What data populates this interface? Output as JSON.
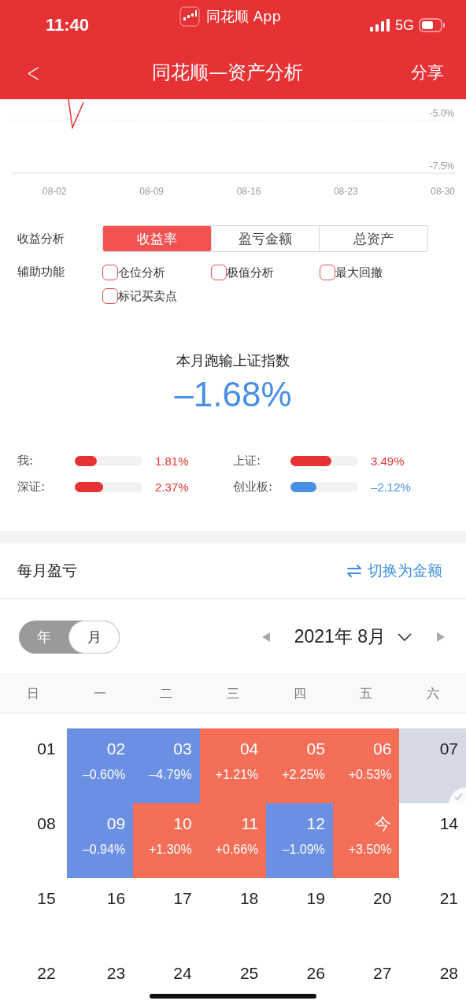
{
  "status_bar": {
    "time": "11:40",
    "app": "同花顺 App",
    "network": "5G"
  },
  "nav": {
    "back": "<",
    "title": "同花顺—资产分析",
    "action": "分享"
  },
  "chart": {
    "y_labels": [
      "-5.0%",
      "-7.5%"
    ],
    "x_labels": [
      "08-02",
      "08-09",
      "08-16",
      "08-23",
      "08-30"
    ]
  },
  "analysis": {
    "label": "收益分析",
    "tabs": [
      {
        "label": "收益率",
        "selected": true
      },
      {
        "label": "盈亏金额",
        "selected": false
      },
      {
        "label": "总资产",
        "selected": false
      }
    ]
  },
  "aux": {
    "label": "辅助功能",
    "options": [
      {
        "label": "仓位分析",
        "checked": false
      },
      {
        "label": "极值分析",
        "checked": false
      },
      {
        "label": "最大回撤",
        "checked": false
      },
      {
        "label": "标记买卖点",
        "checked": false
      }
    ]
  },
  "summary": {
    "title": "本月跑输上证指数",
    "value": "–1.68%"
  },
  "compare": [
    {
      "name": "我:",
      "level": 0.33,
      "value": "1.81%",
      "color": "#e63234"
    },
    {
      "name": "上证:",
      "level": 0.61,
      "value": "3.49%",
      "color": "#e63234"
    },
    {
      "name": "深证:",
      "level": 0.42,
      "value": "2.37%",
      "color": "#e63234"
    },
    {
      "name": "创业板:",
      "level": 0.38,
      "value": "–2.12%",
      "color": "#4a8fe6"
    }
  ],
  "monthly": {
    "title": "每月盈亏",
    "switch": "切换为金额"
  },
  "period": {
    "options": [
      {
        "label": "年",
        "selected": false
      },
      {
        "label": "月",
        "selected": true
      }
    ],
    "month": "2021年 8月"
  },
  "weekdays": [
    "日",
    "一",
    "二",
    "三",
    "四",
    "五",
    "六"
  ],
  "days": [
    {
      "day": "01",
      "kind": "plain"
    },
    {
      "day": "02",
      "change": "–0.60%",
      "kind": "down"
    },
    {
      "day": "03",
      "change": "–4.79%",
      "kind": "down"
    },
    {
      "day": "04",
      "change": "+1.21%",
      "kind": "up"
    },
    {
      "day": "05",
      "change": "+2.25%",
      "kind": "up"
    },
    {
      "day": "06",
      "change": "+0.53%",
      "kind": "up"
    },
    {
      "day": "07",
      "kind": "rest"
    },
    {
      "day": "08",
      "kind": "plain"
    },
    {
      "day": "09",
      "change": "–0.94%",
      "kind": "down"
    },
    {
      "day": "10",
      "change": "+1.30%",
      "kind": "up"
    },
    {
      "day": "11",
      "change": "+0.66%",
      "kind": "up"
    },
    {
      "day": "12",
      "change": "–1.09%",
      "kind": "down"
    },
    {
      "day": "今",
      "change": "+3.50%",
      "kind": "up"
    },
    {
      "day": "14",
      "kind": "plain"
    },
    {
      "day": "15",
      "kind": "plain"
    },
    {
      "day": "16",
      "kind": "plain"
    },
    {
      "day": "17",
      "kind": "plain"
    },
    {
      "day": "18",
      "kind": "plain"
    },
    {
      "day": "19",
      "kind": "plain"
    },
    {
      "day": "20",
      "kind": "plain"
    },
    {
      "day": "21",
      "kind": "plain"
    },
    {
      "day": "22",
      "kind": "plain"
    },
    {
      "day": "23",
      "kind": "plain"
    },
    {
      "day": "24",
      "kind": "plain"
    },
    {
      "day": "25",
      "kind": "plain"
    },
    {
      "day": "26",
      "kind": "plain"
    },
    {
      "day": "27",
      "kind": "plain"
    },
    {
      "day": "28",
      "kind": "plain"
    }
  ]
}
